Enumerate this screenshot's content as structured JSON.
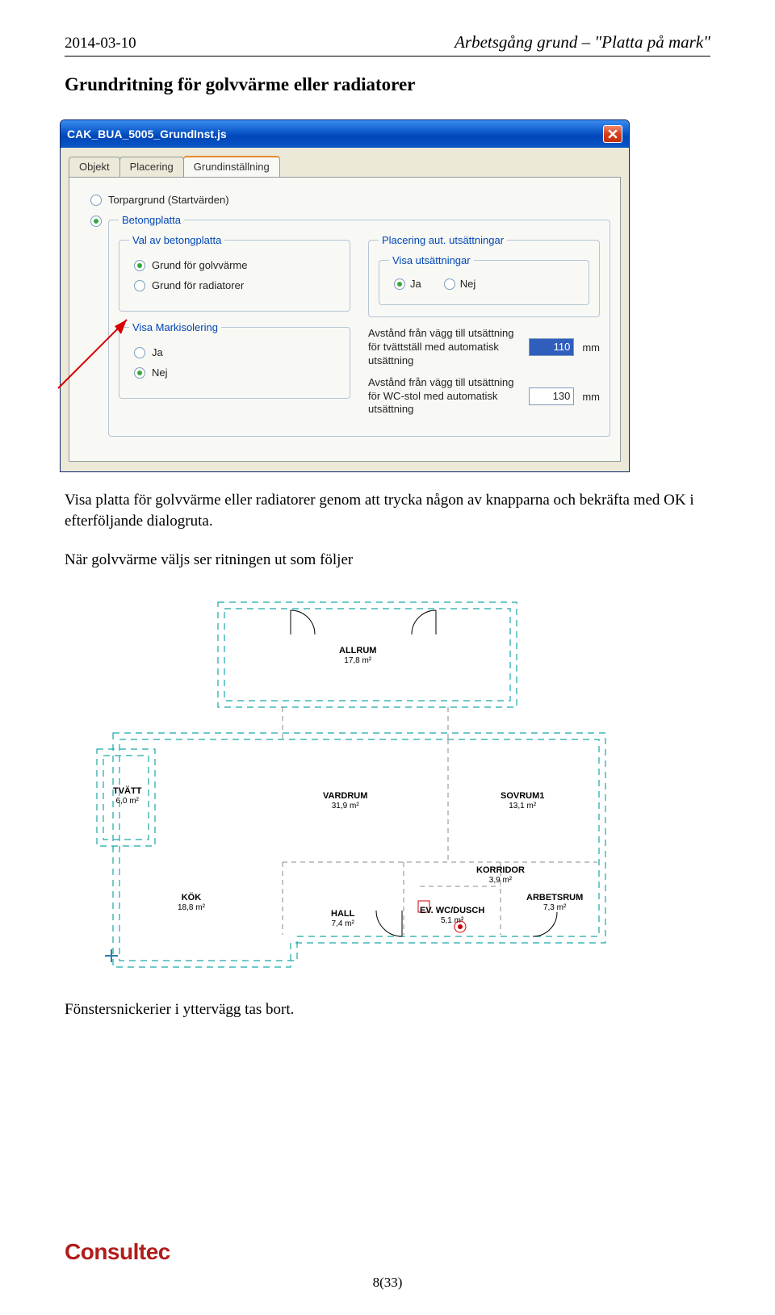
{
  "header": {
    "date": "2014-03-10",
    "doc_title": "Arbetsgång grund – \"Platta på mark\""
  },
  "section": {
    "heading": "Grundritning för golvvärme eller radiatorer",
    "paragraph1": "Visa platta för golvvärme eller radiatorer genom att trycka någon av knapparna och bekräfta med OK i efterföljande dialogruta.",
    "paragraph2": "När golvvärme väljs ser ritningen ut som följer",
    "paragraph3": "Fönstersnickerier i yttervägg tas bort."
  },
  "dialog": {
    "title": "CAK_BUA_5005_GrundInst.js",
    "tabs": [
      "Objekt",
      "Placering",
      "Grundinställning"
    ],
    "torpargrund_label": "Torpargrund (Startvärden)",
    "betongplatta_label": "Betongplatta",
    "group_val_label": "Val av betongplatta",
    "opt_golvvarme": "Grund för golvvärme",
    "opt_radiator": "Grund för radiatorer",
    "group_placering": "Placering aut. utsättningar",
    "group_visa_uts": "Visa utsättningar",
    "ja": "Ja",
    "nej": "Nej",
    "group_markisolering": "Visa Markisolering",
    "field_tvatt": "Avstånd från vägg till utsättning för tvättställ med automatisk utsättning",
    "field_wc": "Avstånd från vägg till utsättning för WC-stol med automatisk utsättning",
    "val_tvatt": "110",
    "val_wc": "130",
    "unit": "mm"
  },
  "floorplan": {
    "rooms": {
      "allrum": {
        "name": "ALLRUM",
        "area": "17,8 m²"
      },
      "tvatt": {
        "name": "TVÄTT",
        "area": "6,0 m²"
      },
      "vardrum": {
        "name": "VARDRUM",
        "area": "31,9 m²"
      },
      "sovrum": {
        "name": "SOVRUM1",
        "area": "13,1 m²"
      },
      "kok": {
        "name": "KÖK",
        "area": "18,8 m²"
      },
      "hall": {
        "name": "HALL",
        "area": "7,4 m²"
      },
      "korridor": {
        "name": "KORRIDOR",
        "area": "3,9 m²"
      },
      "wc": {
        "name": "EV. WC/DUSCH",
        "area": "5,1 m²"
      },
      "arbetsrum": {
        "name": "ARBETSRUM",
        "area": "7,3 m²"
      }
    }
  },
  "footer": {
    "logo": "Consultec",
    "page": "8(33)"
  }
}
